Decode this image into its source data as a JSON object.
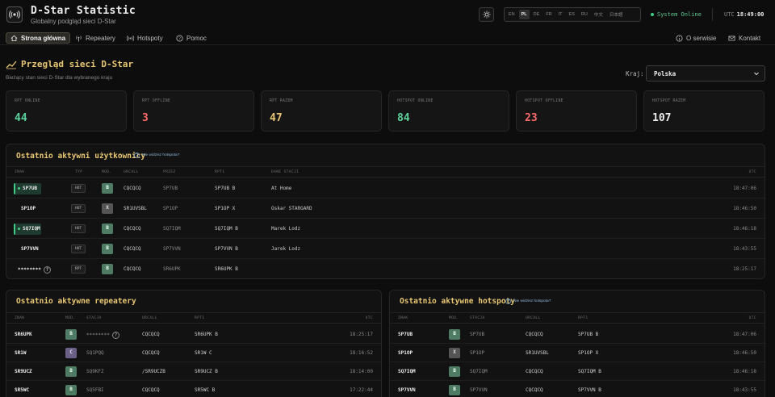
{
  "app": {
    "title": "D-Star Statistic",
    "subtitle": "Globalny podgląd sieci D-Star"
  },
  "languages": [
    "EN",
    "PL",
    "DE",
    "FR",
    "IT",
    "ES",
    "RU",
    "中文",
    "日本語"
  ],
  "active_language": "PL",
  "status": {
    "text": "System Online",
    "utc_label": "UTC",
    "time": "18:49:00"
  },
  "nav": {
    "home": "Strona główna",
    "repeaters": "Repeatery",
    "hotspots": "Hotspoty",
    "help": "Pomoc",
    "about": "O serwisie",
    "contact": "Kontakt"
  },
  "page": {
    "title": "Przegląd sieci D-Star",
    "subtitle": "Bieżący stan sieci D-Star dla wybranego kraju",
    "country_label": "Kraj:",
    "country_value": "Polska"
  },
  "stats": [
    {
      "label": "RPT ONLINE",
      "value": "44"
    },
    {
      "label": "RPT OFFLINE",
      "value": "3"
    },
    {
      "label": "RPT RAZEM",
      "value": "47"
    },
    {
      "label": "HOTSPOT ONLINE",
      "value": "84"
    },
    {
      "label": "HOTSPOT OFFLINE",
      "value": "23"
    },
    {
      "label": "HOTSPOT RAZEM",
      "value": "107"
    }
  ],
  "users": {
    "title": "Ostatnio aktywni użytkownicy",
    "help_link": "Nie widzisz hotspota?",
    "columns": [
      "ZNAK",
      "TYP",
      "MOD.",
      "URCALL",
      "PRZEZ",
      "RPT1",
      "DANE STACJI",
      "UTC"
    ],
    "rows": [
      {
        "call": "SP7UB",
        "type": "HOT",
        "mod": "B",
        "urcall": "CQCQCQ",
        "via": "SP7UB",
        "rpt1": "SP7UB B",
        "station": "At Home",
        "utc": "18:47:06"
      },
      {
        "call": "SP1OP",
        "type": "HOT",
        "mod": "X",
        "urcall": "SR1UVSBL",
        "via": "SP1OP",
        "rpt1": "SP1OP X",
        "station": "Oskar STARGARD",
        "utc": "18:46:50"
      },
      {
        "call": "SQ7IQM",
        "type": "HOT",
        "mod": "B",
        "urcall": "CQCQCQ",
        "via": "SQ7IQM",
        "rpt1": "SQ7IQM B",
        "station": "Marek Lodz",
        "utc": "18:46:18"
      },
      {
        "call": "SP7VVN",
        "type": "HOT",
        "mod": "B",
        "urcall": "CQCQCQ",
        "via": "SP7VVN",
        "rpt1": "SP7VVN B",
        "station": "Jarek Lodz",
        "utc": "18:43:55"
      },
      {
        "call": "********",
        "type": "RPT",
        "mod": "B",
        "urcall": "CQCQCQ",
        "via": "SR6UPK",
        "rpt1": "SR6UPK B",
        "station": "",
        "utc": "18:25:17"
      }
    ]
  },
  "repeaters": {
    "title": "Ostatnio aktywne repeatery",
    "columns": [
      "ZNAK",
      "MOD.",
      "STACJA",
      "URCALL",
      "RPT1",
      "UTC"
    ],
    "rows": [
      {
        "call": "SR6UPK",
        "mod": "B",
        "station": "********",
        "urcall": "CQCQCQ",
        "rpt1": "SR6UPK B",
        "utc": "18:25:17"
      },
      {
        "call": "SR1W",
        "mod": "C",
        "station": "SQ1PQQ",
        "urcall": "CQCQCQ",
        "rpt1": "SR1W C",
        "utc": "18:16:52"
      },
      {
        "call": "SR9UCZ",
        "mod": "B",
        "station": "SQ9KFZ",
        "urcall": "/SR9UCZB",
        "rpt1": "SR9UCZ B",
        "utc": "18:14:00"
      },
      {
        "call": "SR5WC",
        "mod": "B",
        "station": "SQ5FBI",
        "urcall": "CQCQCQ",
        "rpt1": "SR5WC B",
        "utc": "17:22:44"
      }
    ]
  },
  "hotspots": {
    "title": "Ostatnio aktywne hotspoty",
    "help_link": "Nie widzisz hotspota?",
    "columns": [
      "ZNAK",
      "MOD.",
      "STACJA",
      "URCALL",
      "RPT1",
      "UTC"
    ],
    "rows": [
      {
        "call": "SP7UB",
        "mod": "B",
        "station": "SP7UB",
        "urcall": "CQCQCQ",
        "rpt1": "SP7UB B",
        "utc": "18:47:06"
      },
      {
        "call": "SP1OP",
        "mod": "X",
        "station": "SP1OP",
        "urcall": "SR1UVSBL",
        "rpt1": "SP1OP X",
        "utc": "18:46:50"
      },
      {
        "call": "SQ7IQM",
        "mod": "B",
        "station": "SQ7IQM",
        "urcall": "CQCQCQ",
        "rpt1": "SQ7IQM B",
        "utc": "18:46:18"
      },
      {
        "call": "SP7VVN",
        "mod": "B",
        "station": "SP7VVN",
        "urcall": "CQCQCQ",
        "rpt1": "SP7VVN B",
        "utc": "18:43:55"
      }
    ]
  },
  "colors": {
    "accent": "#e8c673",
    "online": "#5cd39b",
    "offline": "#ff6b6b",
    "background": "#0d0d0d"
  },
  "icons": [
    "radio-tower-icon",
    "sun-icon",
    "home-icon",
    "antenna-icon",
    "hotspot-icon",
    "help-icon",
    "info-icon",
    "mail-icon",
    "chart-icon",
    "chevron-down-icon"
  ]
}
